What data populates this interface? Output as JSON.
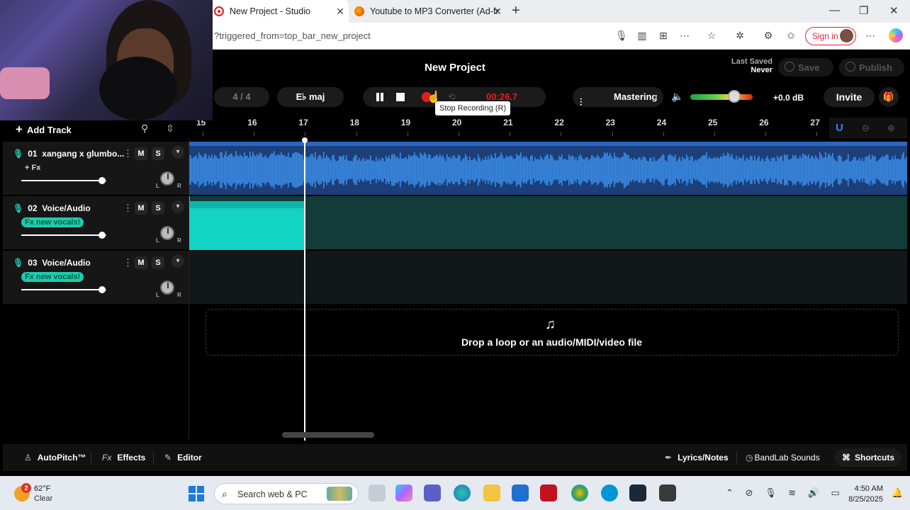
{
  "browser": {
    "tabs": [
      {
        "title": "New Project - Studio"
      },
      {
        "title": "Youtube to MP3 Converter (Ad-fr"
      }
    ],
    "url": "?triggered_from=top_bar_new_project",
    "signin_label": "Sign in"
  },
  "app": {
    "title": "New Project",
    "last_saved_label": "Last Saved",
    "last_saved_value": "Never",
    "save_label": "Save",
    "publish_label": "Publish",
    "time_signature": "4 / 4",
    "key": "E♭ maj",
    "timer": "00:26.7",
    "tooltip": "Stop Recording (R)",
    "mastering_label": "Mastering",
    "volume_db": "+0.0 dB",
    "volume_level": 0.71,
    "invite_label": "Invite",
    "add_track_label": "Add Track",
    "ruler_labels": [
      "15",
      "16",
      "17",
      "18",
      "19",
      "20",
      "21",
      "22",
      "23",
      "24",
      "25",
      "26",
      "27"
    ],
    "playhead_bar": 17.0,
    "tracks": [
      {
        "number": "01",
        "name": "xangang x glumbo...",
        "fx": "+ Fx",
        "mute": "M",
        "solo": "S",
        "volume": 0.95,
        "fx_teal": false
      },
      {
        "number": "02",
        "name": "Voice/Audio",
        "fx": "Fx new vocals!",
        "mute": "M",
        "solo": "S",
        "volume": 0.95,
        "fx_teal": true
      },
      {
        "number": "03",
        "name": "Voice/Audio",
        "fx": "Fx new vocals!",
        "mute": "M",
        "solo": "S",
        "volume": 0.95,
        "fx_teal": true
      }
    ],
    "pan_left": "L",
    "pan_right": "R",
    "drop_text": "Drop a loop or an audio/MIDI/video file",
    "bottom": {
      "autopitch": "AutoPitch™",
      "effects": "Effects",
      "editor": "Editor",
      "lyrics": "Lyrics/Notes",
      "sounds": "BandLab Sounds",
      "shortcuts": "Shortcuts"
    }
  },
  "taskbar": {
    "weather_temp": "62°F",
    "weather_cond": "Clear",
    "weather_badge": "2",
    "search_placeholder": "Search web & PC",
    "time": "4:50 AM",
    "date": "8/25/2025"
  },
  "colors": {
    "accent_teal": "#21c9b4",
    "record_red": "#e02020",
    "track1_blue": "#3a8ee8",
    "magnet_blue": "#3a7bff"
  }
}
